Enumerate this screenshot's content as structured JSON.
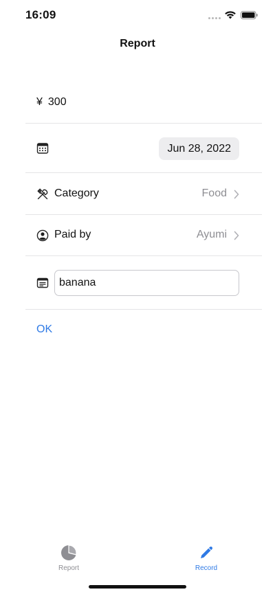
{
  "status_bar": {
    "time": "16:09"
  },
  "nav": {
    "title": "Report"
  },
  "form": {
    "currency_symbol": "¥",
    "amount": "300",
    "date": "Jun 28, 2022",
    "category": {
      "label": "Category",
      "value": "Food",
      "icon": "fork-knife-icon"
    },
    "paid_by": {
      "label": "Paid by",
      "value": "Ayumi",
      "icon": "person-circle-icon"
    },
    "memo": {
      "value": "banana",
      "icon": "note-icon"
    },
    "calendar_icon": "calendar-icon"
  },
  "actions": {
    "ok_label": "OK"
  },
  "tab_bar": {
    "tabs": [
      {
        "label": "Report",
        "icon": "pie-chart-icon",
        "selected": false
      },
      {
        "label": "Record",
        "icon": "pencil-icon",
        "selected": true
      }
    ]
  },
  "colors": {
    "accent": "#2f7ae5",
    "secondary_text": "#8e8e93",
    "pill_bg": "#ededef",
    "divider": "#e4e4e6"
  }
}
